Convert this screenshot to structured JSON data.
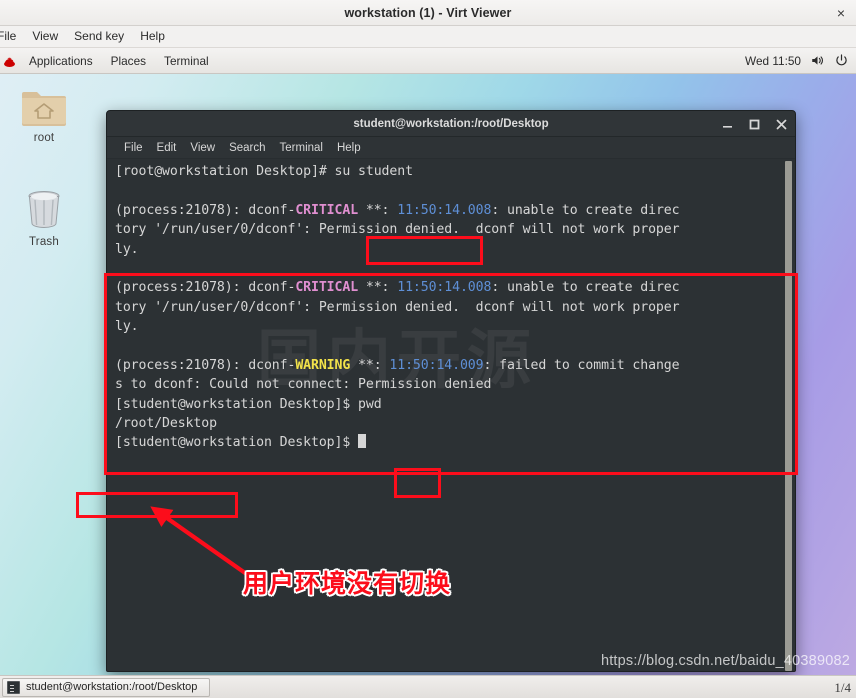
{
  "viewer": {
    "title": "workstation (1) - Virt Viewer",
    "close_label": "×",
    "menu": [
      "File",
      "View",
      "Send key",
      "Help"
    ]
  },
  "gnome_panel": {
    "applications": "Applications",
    "places": "Places",
    "terminal": "Terminal",
    "clock": "Wed 11:50",
    "volume_icon": "volume-icon",
    "power_icon": "power-icon",
    "redhat_icon": "redhat-logo-icon"
  },
  "desktop": {
    "icons": [
      {
        "label": "root",
        "icon": "home-folder-icon"
      },
      {
        "label": "Trash",
        "icon": "trash-can-icon"
      }
    ],
    "watermark_url": "https://blog.csdn.net/baidu_40389082",
    "page_number": "1/4",
    "terminal_bg_watermark": "国内开源"
  },
  "terminal": {
    "title": "student@workstation:/root/Desktop",
    "menu": [
      "File",
      "Edit",
      "View",
      "Search",
      "Terminal",
      "Help"
    ],
    "window_buttons": {
      "minimize": "minimize-icon",
      "maximize": "maximize-icon",
      "close": "close-icon"
    },
    "lines": [
      {
        "id": "l1",
        "segments": [
          {
            "t": "[root@workstation Desktop]# su student",
            "c": "plain"
          }
        ]
      },
      {
        "id": "l2",
        "segments": [
          {
            "t": "",
            "c": "plain"
          }
        ]
      },
      {
        "id": "l3",
        "segments": [
          {
            "t": "(process:21078): dconf-",
            "c": "plain"
          },
          {
            "t": "CRITICAL",
            "c": "crit"
          },
          {
            "t": " **: ",
            "c": "plain"
          },
          {
            "t": "11:50:14.008",
            "c": "time"
          },
          {
            "t": ": unable to create direc",
            "c": "plain"
          }
        ]
      },
      {
        "id": "l4",
        "segments": [
          {
            "t": "tory '/run/user/0/dconf': Permission denied.  dconf will not work proper",
            "c": "plain"
          }
        ]
      },
      {
        "id": "l5",
        "segments": [
          {
            "t": "ly.",
            "c": "plain"
          }
        ]
      },
      {
        "id": "l6",
        "segments": [
          {
            "t": "",
            "c": "plain"
          }
        ]
      },
      {
        "id": "l7",
        "segments": [
          {
            "t": "(process:21078): dconf-",
            "c": "plain"
          },
          {
            "t": "CRITICAL",
            "c": "crit"
          },
          {
            "t": " **: ",
            "c": "plain"
          },
          {
            "t": "11:50:14.008",
            "c": "time"
          },
          {
            "t": ": unable to create direc",
            "c": "plain"
          }
        ]
      },
      {
        "id": "l8",
        "segments": [
          {
            "t": "tory '/run/user/0/dconf': Permission denied.  dconf will not work proper",
            "c": "plain"
          }
        ]
      },
      {
        "id": "l9",
        "segments": [
          {
            "t": "ly.",
            "c": "plain"
          }
        ]
      },
      {
        "id": "l10",
        "segments": [
          {
            "t": "",
            "c": "plain"
          }
        ]
      },
      {
        "id": "l11",
        "segments": [
          {
            "t": "(process:21078): dconf-",
            "c": "plain"
          },
          {
            "t": "WARNING",
            "c": "warn"
          },
          {
            "t": " **: ",
            "c": "plain"
          },
          {
            "t": "11:50:14.009",
            "c": "time"
          },
          {
            "t": ": failed to commit change",
            "c": "plain"
          }
        ]
      },
      {
        "id": "l12",
        "segments": [
          {
            "t": "s to dconf: Could not connect: Permission denied",
            "c": "plain"
          }
        ]
      },
      {
        "id": "l13",
        "segments": [
          {
            "t": "[student@workstation Desktop]$ pwd",
            "c": "plain"
          }
        ]
      },
      {
        "id": "l14",
        "segments": [
          {
            "t": "/root/Desktop",
            "c": "plain"
          }
        ]
      },
      {
        "id": "l15",
        "segments": [
          {
            "t": "[student@workstation Desktop]$ ",
            "c": "plain"
          },
          {
            "t": "█",
            "c": "cursor"
          }
        ]
      }
    ]
  },
  "annotations": {
    "note_text": "用户环境没有切换",
    "highlight_color": "#fc0d1b",
    "boxes": [
      {
        "name": "su-student",
        "label": "su student"
      },
      {
        "name": "dconf-errors",
        "label": ""
      },
      {
        "name": "pwd-command",
        "label": "pwd"
      },
      {
        "name": "pwd-output",
        "label": "/root/Desktop"
      }
    ]
  },
  "taskbar": {
    "window_label": "student@workstation:/root/Desktop"
  }
}
